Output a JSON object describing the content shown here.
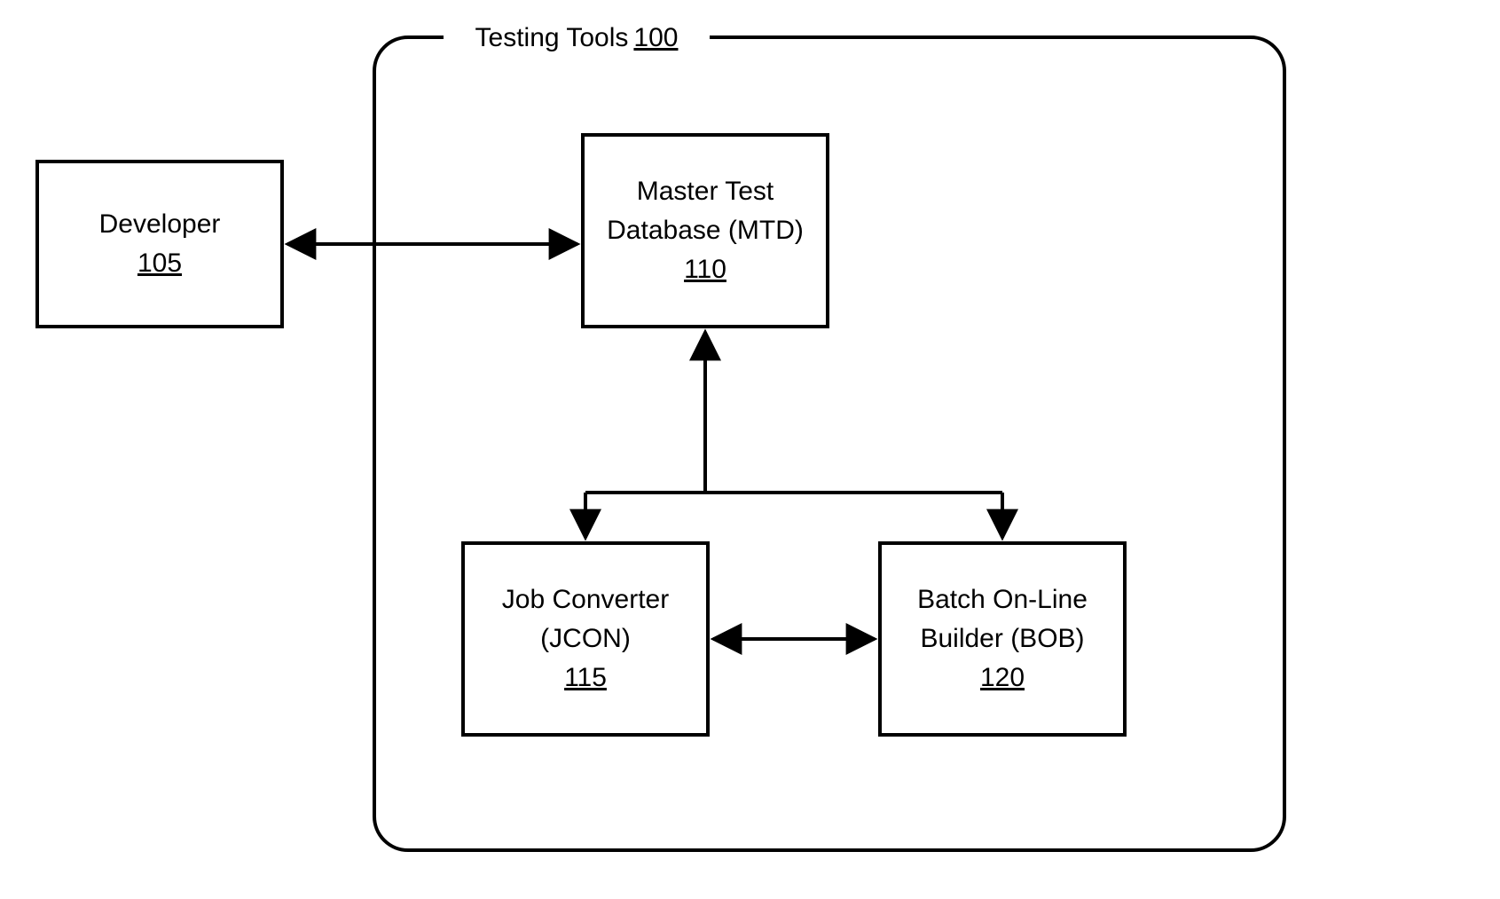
{
  "frame": {
    "title": "Testing Tools",
    "ref": "100"
  },
  "nodes": {
    "developer": {
      "title": "Developer",
      "ref": "105"
    },
    "mtd": {
      "line1": "Master Test",
      "line2": "Database (MTD)",
      "ref": "110"
    },
    "jcon": {
      "line1": "Job Converter",
      "line2": "(JCON)",
      "ref": "115"
    },
    "bob": {
      "line1": "Batch On-Line",
      "line2": "Builder (BOB)",
      "ref": "120"
    }
  },
  "edges": [
    {
      "from": "developer",
      "to": "mtd",
      "bidirectional": true
    },
    {
      "from": "mtd",
      "to": "jcon",
      "bidirectional": true
    },
    {
      "from": "mtd",
      "to": "bob",
      "bidirectional": true
    },
    {
      "from": "jcon",
      "to": "bob",
      "bidirectional": true
    }
  ]
}
